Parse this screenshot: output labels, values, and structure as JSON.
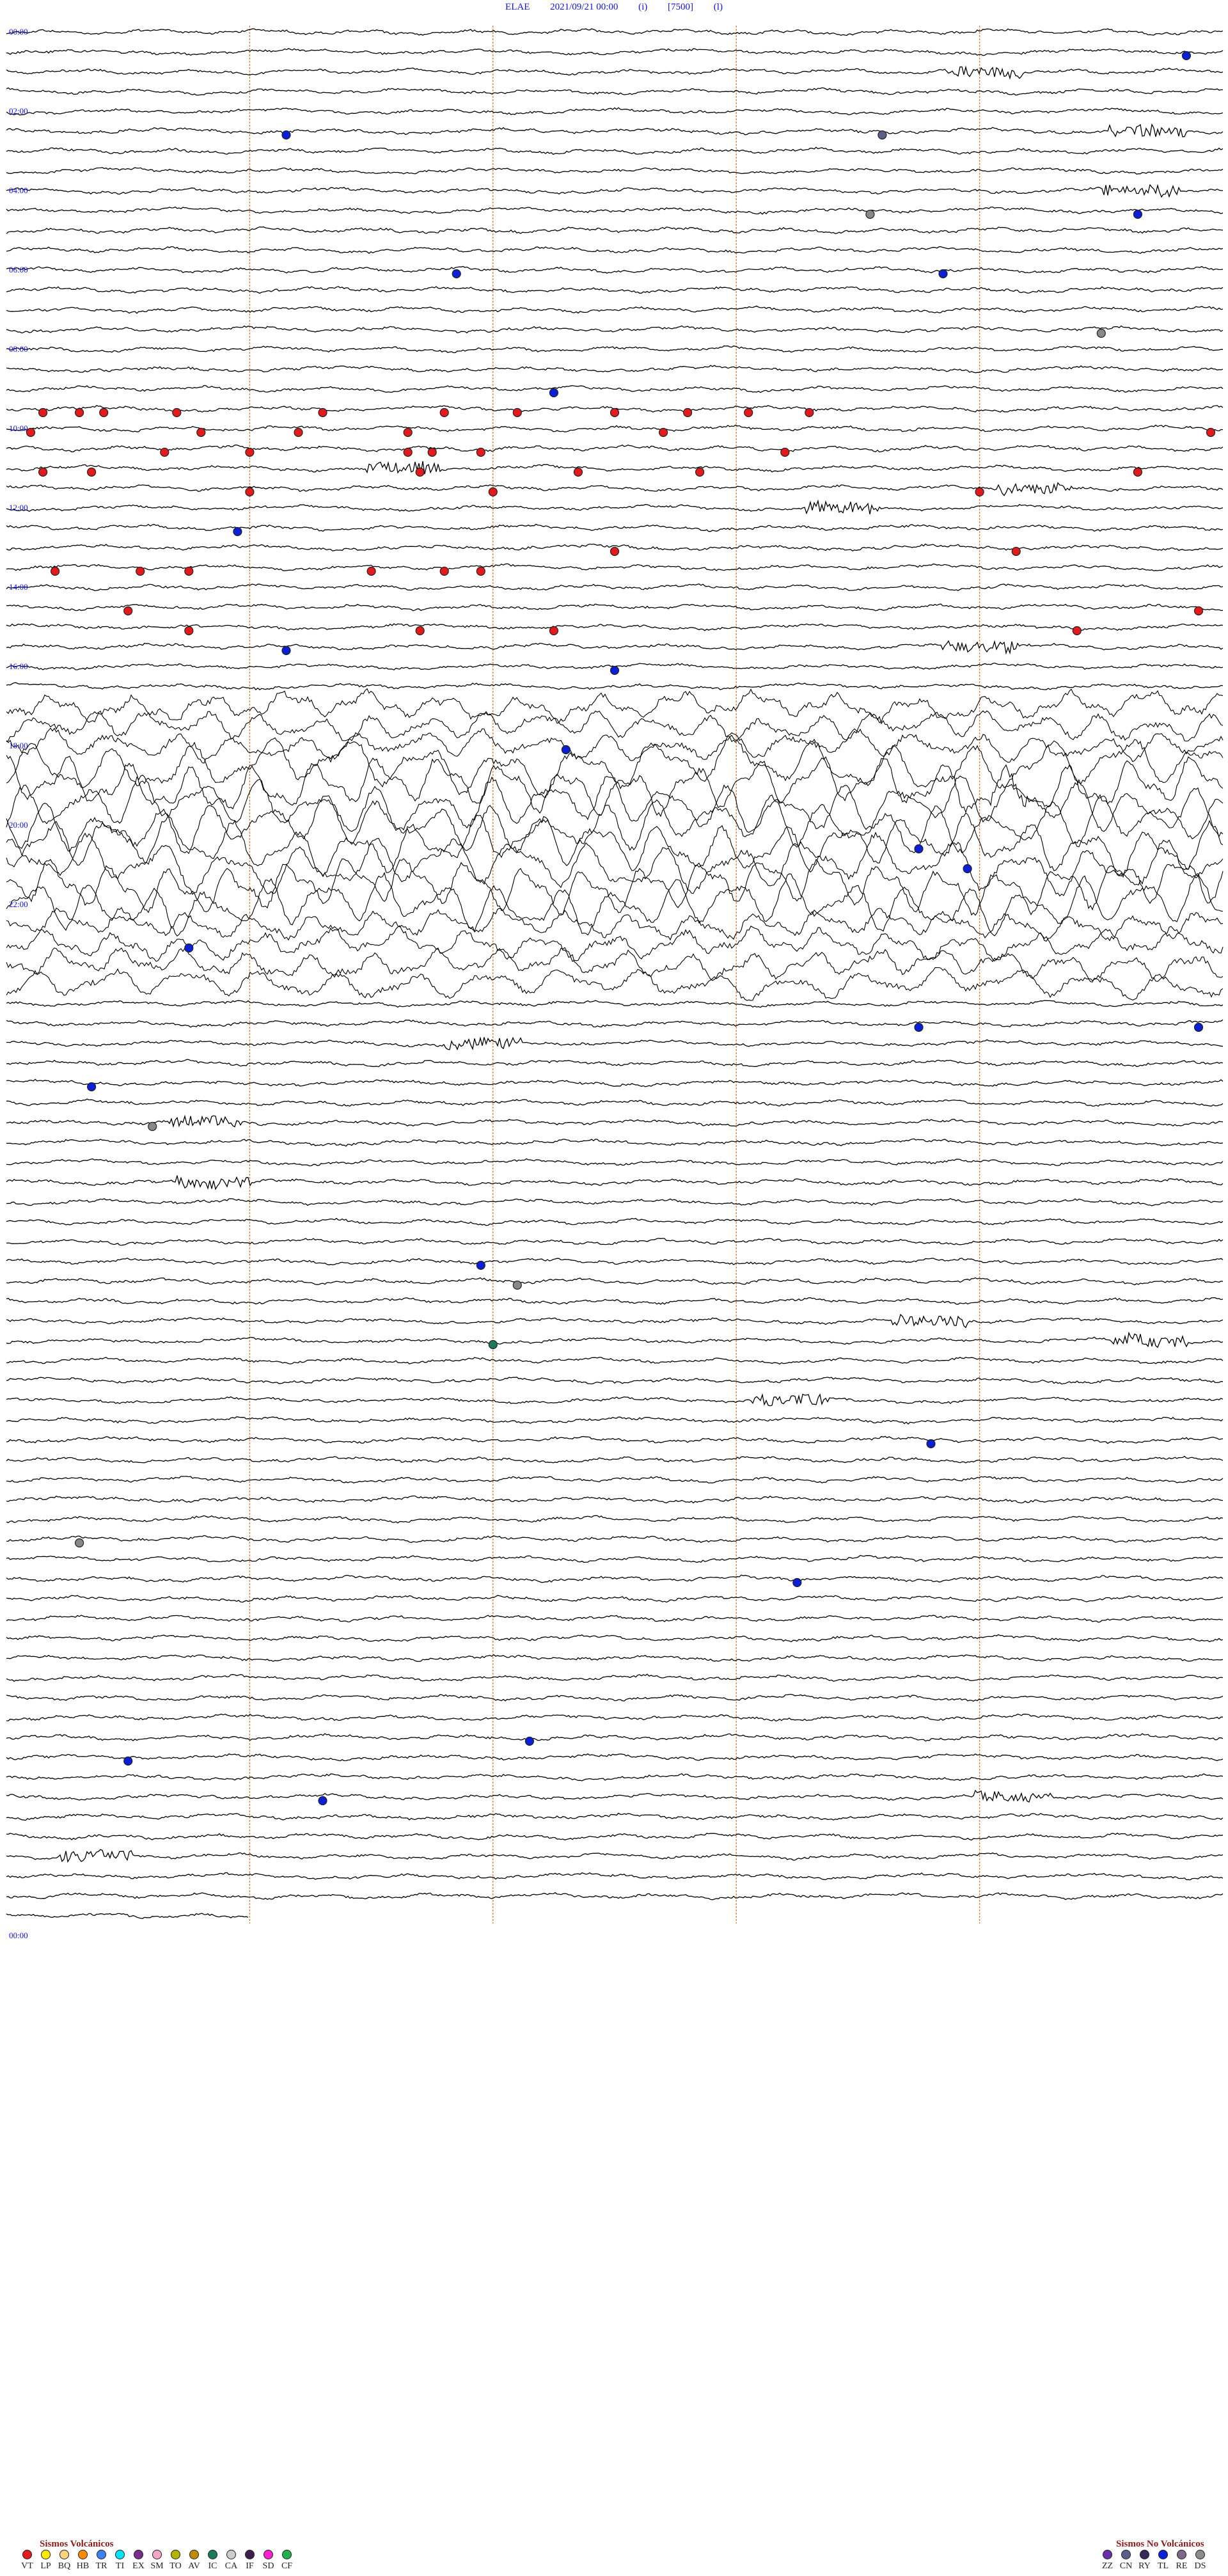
{
  "header": {
    "station": "ELAE",
    "datetime": "2021/09/21 00:00",
    "flag1": "(i)",
    "scale": "[7500]",
    "flag2": "(l)"
  },
  "chart_data": {
    "type": "line",
    "title": "ELAE 2021/09/21 00:00 (i) [7500] (l)",
    "hour_labels": [
      "00:00",
      "02:00",
      "04:00",
      "06:00",
      "08:00",
      "10:00",
      "12:00",
      "14:00",
      "16:00",
      "18:00",
      "20:00",
      "22:00",
      "00:00"
    ],
    "rows_per_hour": 4,
    "total_rows": 96,
    "minutes_per_row": 15,
    "grid": true,
    "x_gridline_fractions": [
      0.2,
      0.4,
      0.6,
      0.8
    ],
    "high_amplitude_rows": [
      34,
      35,
      36,
      37,
      38,
      39,
      40,
      41,
      42,
      43,
      44,
      45,
      46,
      47,
      48
    ],
    "events": [
      {
        "row": 1,
        "pos": 0.97,
        "type": "TL"
      },
      {
        "row": 5,
        "pos": 0.23,
        "type": "TL"
      },
      {
        "row": 9,
        "pos": 0.93,
        "type": "TL"
      },
      {
        "row": 12,
        "pos": 0.37,
        "type": "TL"
      },
      {
        "row": 12,
        "pos": 0.77,
        "type": "TL"
      },
      {
        "row": 18,
        "pos": 0.45,
        "type": "TL"
      },
      {
        "row": 19,
        "pos": 0.03,
        "type": "VT"
      },
      {
        "row": 19,
        "pos": 0.06,
        "type": "VT"
      },
      {
        "row": 19,
        "pos": 0.08,
        "type": "VT"
      },
      {
        "row": 19,
        "pos": 0.14,
        "type": "VT"
      },
      {
        "row": 19,
        "pos": 0.26,
        "type": "VT"
      },
      {
        "row": 19,
        "pos": 0.36,
        "type": "VT"
      },
      {
        "row": 19,
        "pos": 0.42,
        "type": "VT"
      },
      {
        "row": 19,
        "pos": 0.5,
        "type": "VT"
      },
      {
        "row": 19,
        "pos": 0.56,
        "type": "VT"
      },
      {
        "row": 19,
        "pos": 0.61,
        "type": "VT"
      },
      {
        "row": 19,
        "pos": 0.66,
        "type": "VT"
      },
      {
        "row": 20,
        "pos": 0.02,
        "type": "VT"
      },
      {
        "row": 20,
        "pos": 0.16,
        "type": "VT"
      },
      {
        "row": 20,
        "pos": 0.24,
        "type": "VT"
      },
      {
        "row": 20,
        "pos": 0.33,
        "type": "VT"
      },
      {
        "row": 20,
        "pos": 0.54,
        "type": "VT"
      },
      {
        "row": 20,
        "pos": 0.99,
        "type": "VT"
      },
      {
        "row": 21,
        "pos": 0.13,
        "type": "VT"
      },
      {
        "row": 21,
        "pos": 0.2,
        "type": "VT"
      },
      {
        "row": 21,
        "pos": 0.33,
        "type": "VT"
      },
      {
        "row": 21,
        "pos": 0.35,
        "type": "VT"
      },
      {
        "row": 21,
        "pos": 0.39,
        "type": "VT"
      },
      {
        "row": 21,
        "pos": 0.64,
        "type": "VT"
      },
      {
        "row": 22,
        "pos": 0.03,
        "type": "VT"
      },
      {
        "row": 22,
        "pos": 0.07,
        "type": "VT"
      },
      {
        "row": 22,
        "pos": 0.34,
        "type": "VT"
      },
      {
        "row": 22,
        "pos": 0.47,
        "type": "VT"
      },
      {
        "row": 22,
        "pos": 0.57,
        "type": "VT"
      },
      {
        "row": 22,
        "pos": 0.93,
        "type": "VT"
      },
      {
        "row": 23,
        "pos": 0.2,
        "type": "VT"
      },
      {
        "row": 23,
        "pos": 0.4,
        "type": "VT"
      },
      {
        "row": 23,
        "pos": 0.8,
        "type": "VT"
      },
      {
        "row": 25,
        "pos": 0.19,
        "type": "TL"
      },
      {
        "row": 26,
        "pos": 0.5,
        "type": "VT"
      },
      {
        "row": 26,
        "pos": 0.83,
        "type": "VT"
      },
      {
        "row": 27,
        "pos": 0.04,
        "type": "VT"
      },
      {
        "row": 27,
        "pos": 0.11,
        "type": "VT"
      },
      {
        "row": 27,
        "pos": 0.15,
        "type": "VT"
      },
      {
        "row": 27,
        "pos": 0.3,
        "type": "VT"
      },
      {
        "row": 27,
        "pos": 0.36,
        "type": "VT"
      },
      {
        "row": 27,
        "pos": 0.39,
        "type": "VT"
      },
      {
        "row": 29,
        "pos": 0.1,
        "type": "VT"
      },
      {
        "row": 29,
        "pos": 0.98,
        "type": "VT"
      },
      {
        "row": 30,
        "pos": 0.15,
        "type": "VT"
      },
      {
        "row": 30,
        "pos": 0.34,
        "type": "VT"
      },
      {
        "row": 30,
        "pos": 0.45,
        "type": "VT"
      },
      {
        "row": 30,
        "pos": 0.88,
        "type": "VT"
      },
      {
        "row": 31,
        "pos": 0.23,
        "type": "TL"
      },
      {
        "row": 32,
        "pos": 0.5,
        "type": "TL"
      },
      {
        "row": 36,
        "pos": 0.46,
        "type": "TL"
      },
      {
        "row": 41,
        "pos": 0.75,
        "type": "TL"
      },
      {
        "row": 42,
        "pos": 0.79,
        "type": "TL"
      },
      {
        "row": 46,
        "pos": 0.15,
        "type": "TL"
      },
      {
        "row": 50,
        "pos": 0.75,
        "type": "TL"
      },
      {
        "row": 50,
        "pos": 0.98,
        "type": "TL"
      },
      {
        "row": 53,
        "pos": 0.07,
        "type": "TL"
      },
      {
        "row": 62,
        "pos": 0.39,
        "type": "TL"
      },
      {
        "row": 66,
        "pos": 0.4,
        "type": "IC"
      },
      {
        "row": 71,
        "pos": 0.76,
        "type": "TL"
      },
      {
        "row": 78,
        "pos": 0.65,
        "type": "TL"
      },
      {
        "row": 86,
        "pos": 0.43,
        "type": "TL"
      },
      {
        "row": 87,
        "pos": 0.1,
        "type": "TL"
      },
      {
        "row": 89,
        "pos": 0.26,
        "type": "TL"
      },
      {
        "row": 5,
        "pos": 0.72,
        "type": "CN"
      },
      {
        "row": 9,
        "pos": 0.71,
        "type": "BE"
      },
      {
        "row": 15,
        "pos": 0.9,
        "type": "BE"
      },
      {
        "row": 55,
        "pos": 0.12,
        "type": "BE"
      },
      {
        "row": 63,
        "pos": 0.42,
        "type": "BE"
      },
      {
        "row": 76,
        "pos": 0.06,
        "type": "BE"
      }
    ]
  },
  "legend": {
    "volcanic": {
      "title": "Sismos Volcánicos",
      "items": [
        {
          "code": "VT",
          "color": "#e31a1c"
        },
        {
          "code": "LP",
          "color": "#ffea00"
        },
        {
          "code": "BQ",
          "color": "#ffd27f"
        },
        {
          "code": "HB",
          "color": "#ff8c00"
        },
        {
          "code": "TR",
          "color": "#3b82f6"
        },
        {
          "code": "TI",
          "color": "#00e5ff"
        },
        {
          "code": "EX",
          "color": "#7b2d8e"
        },
        {
          "code": "SM",
          "color": "#f4a6c9"
        },
        {
          "code": "TO",
          "color": "#b3b300"
        },
        {
          "code": "AV",
          "color": "#c08a00"
        },
        {
          "code": "IC",
          "color": "#1b7a5a"
        },
        {
          "code": "CA",
          "color": "#cccccc"
        },
        {
          "code": "IF",
          "color": "#3d1f4a"
        },
        {
          "code": "SD",
          "color": "#ff1fd0"
        },
        {
          "code": "CF",
          "color": "#22b14c"
        }
      ]
    },
    "nonvolcanic": {
      "title": "Sismos No Volcánicos",
      "items": [
        {
          "code": "ZZ",
          "color": "#6a2fa8"
        },
        {
          "code": "CN",
          "color": "#5e5e8a"
        },
        {
          "code": "RY",
          "color": "#3a2a5a"
        },
        {
          "code": "TL",
          "color": "#0b1fd6"
        },
        {
          "code": "RE",
          "color": "#7a6a8a"
        },
        {
          "code": "DS",
          "color": "#8c8c8c"
        }
      ]
    }
  }
}
